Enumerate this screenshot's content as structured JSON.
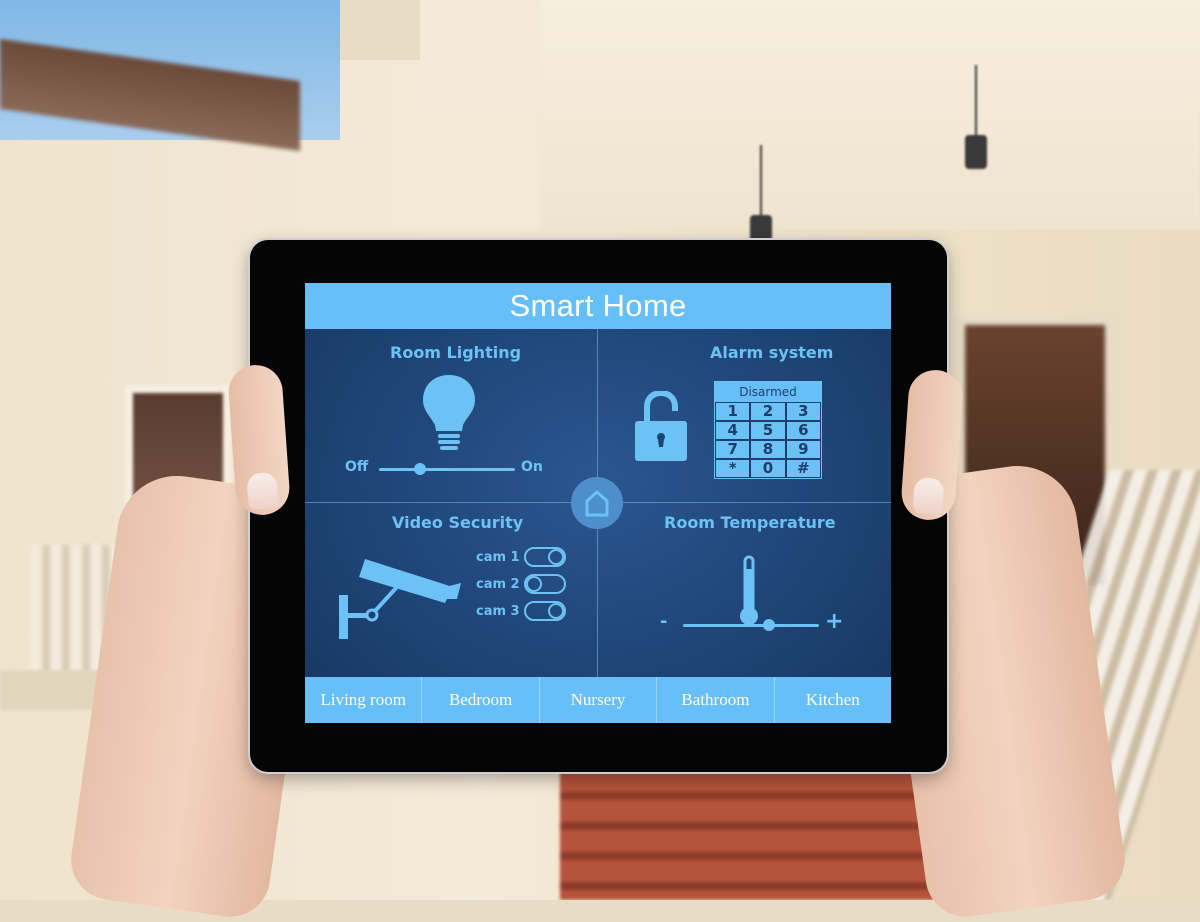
{
  "scene": {
    "description": "Hands holding a tablet showing a smart home control app in front of a blurred house exterior"
  },
  "app": {
    "title": "Smart Home",
    "accent_color": "#66bff9",
    "panel_bg_color": "#1f4577",
    "panels": {
      "lighting": {
        "title": "Room Lighting",
        "icon": "light-bulb-icon",
        "slider_min_label": "Off",
        "slider_max_label": "On",
        "slider_value_fraction": 0.3
      },
      "alarm": {
        "title": "Alarm system",
        "icon": "unlocked-padlock-icon",
        "status": "Disarmed",
        "keys": [
          "1",
          "2",
          "3",
          "4",
          "5",
          "6",
          "7",
          "8",
          "9",
          "*",
          "0",
          "#"
        ]
      },
      "video": {
        "title": "Video Security",
        "icon": "security-camera-icon",
        "cameras": [
          {
            "label": "cam 1",
            "state": "on"
          },
          {
            "label": "cam 2",
            "state": "off"
          },
          {
            "label": "cam 3",
            "state": "on"
          }
        ]
      },
      "temperature": {
        "title": "Room Temperature",
        "icon": "thermometer-icon",
        "slider_min_label": "-",
        "slider_max_label": "+",
        "slider_value_fraction": 0.63
      }
    },
    "home_button_icon": "house-icon",
    "rooms": [
      "Living room",
      "Bedroom",
      "Nursery",
      "Bathroom",
      "Kitchen"
    ]
  }
}
